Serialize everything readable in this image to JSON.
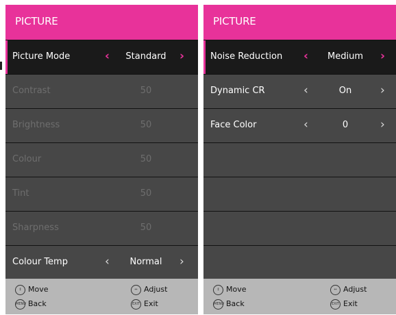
{
  "left_panel": {
    "title": "PICTURE",
    "rows": [
      {
        "label": "Picture Mode",
        "value": "Standard"
      },
      {
        "label": "Contrast",
        "value": "50"
      },
      {
        "label": "Brightness",
        "value": "50"
      },
      {
        "label": "Colour",
        "value": "50"
      },
      {
        "label": "Tint",
        "value": "50"
      },
      {
        "label": "Sharpness",
        "value": "50"
      },
      {
        "label": "Colour Temp",
        "value": "Normal"
      }
    ]
  },
  "right_panel": {
    "title": "PICTURE",
    "rows": [
      {
        "label": "Noise Reduction",
        "value": "Medium"
      },
      {
        "label": "Dynamic CR",
        "value": "On"
      },
      {
        "label": "Face Color",
        "value": "0"
      }
    ]
  },
  "footer": {
    "move": "Move",
    "back": "Back",
    "adjust": "Adjust",
    "exit": "Exit",
    "menu_icon_text": "MENU",
    "exit_icon_text": "EXIT"
  },
  "icons": {
    "left_arrow": "‹",
    "right_arrow": "›"
  },
  "colors": {
    "accent": "#e8329a",
    "row_bg": "#474747",
    "selected_bg": "#1a1a1a",
    "footer_bg": "#b7b7b7",
    "disabled_text": "#6e6e6e"
  }
}
